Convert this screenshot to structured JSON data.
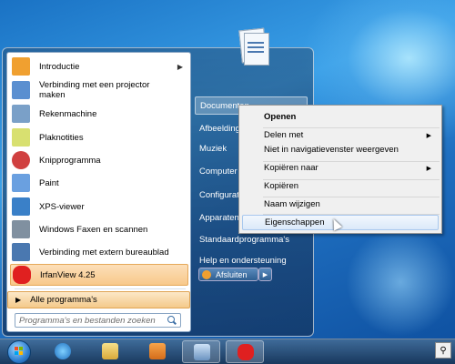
{
  "programs": [
    {
      "label": "Introductie",
      "icon": "windows-intro-icon",
      "color": "#f0a030",
      "has_submenu": true
    },
    {
      "label": "Verbinding met een projector maken",
      "icon": "projector-icon",
      "color": "#5a8fd0"
    },
    {
      "label": "Rekenmachine",
      "icon": "calculator-icon",
      "color": "#7aa0c8"
    },
    {
      "label": "Plaknotities",
      "icon": "sticky-notes-icon",
      "color": "#d8e070"
    },
    {
      "label": "Knipprogramma",
      "icon": "snipping-tool-icon",
      "color": "#d04040"
    },
    {
      "label": "Paint",
      "icon": "paint-icon",
      "color": "#6aa0e0"
    },
    {
      "label": "XPS-viewer",
      "icon": "xps-viewer-icon",
      "color": "#3a80c8"
    },
    {
      "label": "Windows Faxen en scannen",
      "icon": "fax-scan-icon",
      "color": "#8090a0"
    },
    {
      "label": "Verbinding met extern bureaublad",
      "icon": "remote-desktop-icon",
      "color": "#4a78b0"
    },
    {
      "label": "IrfanView 4.25",
      "icon": "irfanview-icon",
      "color": "#e02020"
    }
  ],
  "all_programs": "Alle programma's",
  "search_placeholder": "Programma's en bestanden zoeken",
  "right_items": [
    {
      "label": "Documenten"
    },
    {
      "label": "Afbeeldingen"
    },
    {
      "label": "Muziek"
    },
    {
      "label": "Computer"
    },
    {
      "label": "Configuratiescherm"
    },
    {
      "label": "Apparaten en printers"
    },
    {
      "label": "Standaardprogramma's"
    },
    {
      "label": "Help en ondersteuning"
    }
  ],
  "shutdown_label": "Afsluiten",
  "context_menu": [
    {
      "label": "Openen",
      "bold": true
    },
    {
      "label": "Delen met",
      "submenu": true
    },
    {
      "label": "Niet in navigatievenster weergeven"
    },
    {
      "label": "Kopiëren naar",
      "submenu": true
    },
    {
      "label": "Kopiëren"
    },
    {
      "label": "Naam wijzigen"
    },
    {
      "label": "Eigenschappen",
      "hover": true
    }
  ],
  "taskbar": [
    "start-orb",
    "internet-explorer-icon",
    "explorer-folder-icon",
    "media-player-icon",
    "remote-desktop-icon",
    "irfanview-icon"
  ],
  "colors": {
    "highlight": "#f8c98a",
    "ctx_hover": "#dbe9f9"
  }
}
